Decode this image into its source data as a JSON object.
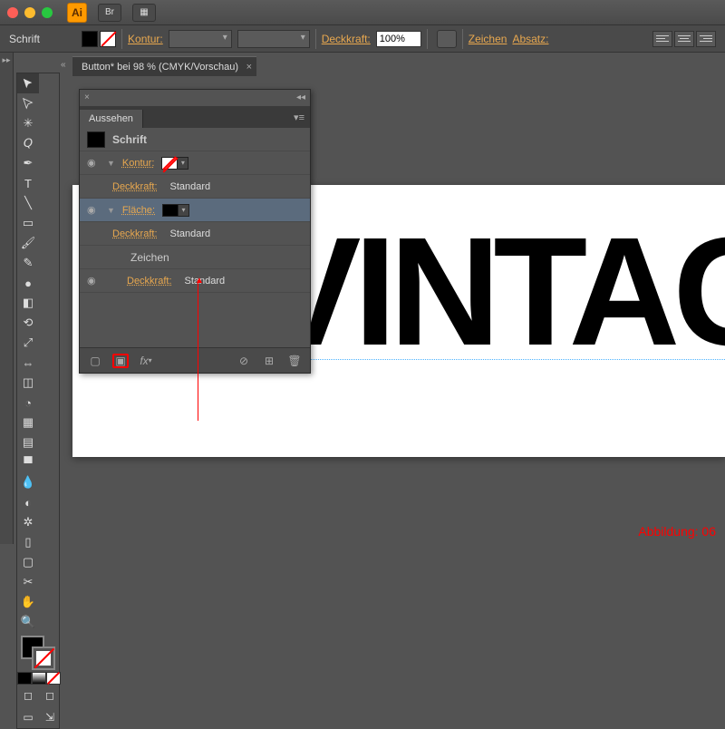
{
  "titlebar": {
    "app": "Ai",
    "btn1": "Br"
  },
  "controlbar": {
    "context": "Schrift",
    "stroke_label": "Kontur:",
    "opacity_label": "Deckkraft:",
    "opacity_value": "100%",
    "char_label": "Zeichen",
    "para_label": "Absatz:"
  },
  "doc_tab": "Button* bei 98 % (CMYK/Vorschau)",
  "panel": {
    "title": "Aussehen",
    "target": "Schrift",
    "rows": {
      "stroke": "Kontur:",
      "opacity": "Deckkraft:",
      "std": "Standard",
      "fill": "Fläche:",
      "char": "Zeichen"
    },
    "fx": "fx"
  },
  "artwork_text": "VINTAGE",
  "caption": "Abbildung: 06"
}
